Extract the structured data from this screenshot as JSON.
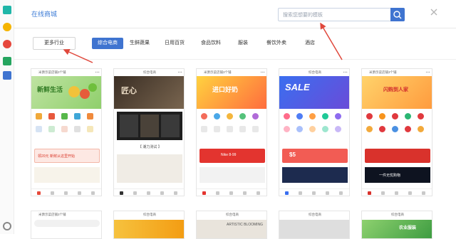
{
  "header": {
    "title": "在线商城",
    "search_placeholder": "搜索您想要的模板"
  },
  "filters": {
    "more_label": "更多行业",
    "categories": [
      "综合电商",
      "生鲜蔬果",
      "日用百货",
      "食品饮料",
      "服装",
      "餐饮外卖",
      "酒店"
    ],
    "active_index": 0
  },
  "cards": [
    {
      "shop": "米萧示菜店铺3个铺",
      "banner_text": "新鲜生活",
      "promo_text": "领20元 新鲜从这里开始"
    },
    {
      "shop": "综合电商",
      "banner_text": "匠心",
      "promo_text": "【 潮力测试 】"
    },
    {
      "shop": "米萧示菜店铺3个铺",
      "banner_text": "进口好奶",
      "promo_text": "Nike 8-99"
    },
    {
      "shop": "综合电商",
      "banner_text": "SALE",
      "promo_text": "$5"
    },
    {
      "shop": "米萧示菜店铺3个铺",
      "banner_text": "闪购到人家",
      "promo_text": "一件无忧购物"
    }
  ],
  "bottom_cards": [
    {
      "shop": "米萧示菜店铺3个铺"
    },
    {
      "shop": "综合电商"
    },
    {
      "shop": "综合电商",
      "banner_text": "ARTISTIC BLOOMING"
    },
    {
      "shop": "综合电商"
    },
    {
      "shop": "综合电商",
      "banner_text": "农业服装"
    }
  ],
  "colors": {
    "accent": "#3f74d0",
    "annotation_arrow": "#e0483c"
  }
}
